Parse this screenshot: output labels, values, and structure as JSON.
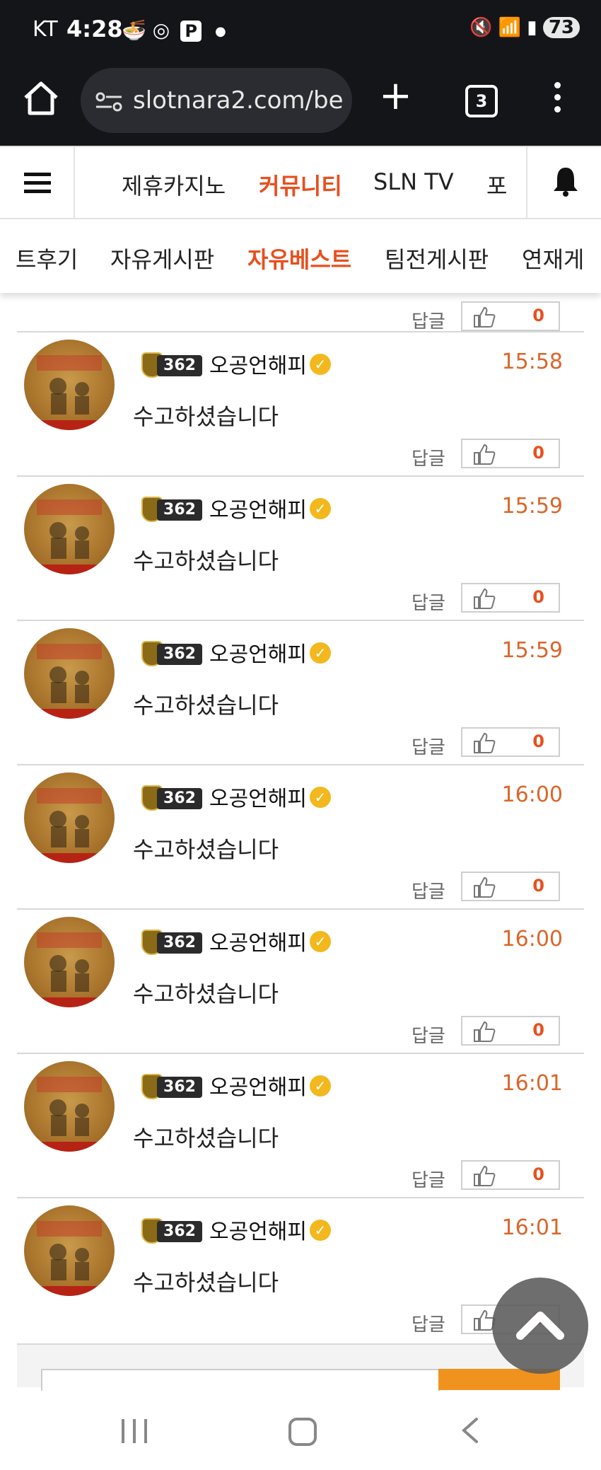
{
  "status_bar": {
    "carrier": "KT",
    "time": "4:28",
    "battery": "73",
    "p_icon_label": "P"
  },
  "browser": {
    "url": "slotnara2.com/be",
    "tab_count": "3"
  },
  "site_nav": {
    "items": [
      {
        "label": "제휴카지노",
        "active": false
      },
      {
        "label": "커뮤니티",
        "active": true
      },
      {
        "label": "SLN TV",
        "active": false
      },
      {
        "label": "포",
        "active": false
      }
    ]
  },
  "sub_nav": {
    "items": [
      {
        "label": "트후기",
        "active": false
      },
      {
        "label": "자유게시판",
        "active": false
      },
      {
        "label": "자유베스트",
        "active": true
      },
      {
        "label": "팀전게시판",
        "active": false
      },
      {
        "label": "연재게",
        "active": false
      }
    ]
  },
  "top_partial": {
    "reply_label": "답글",
    "likes": "0"
  },
  "comments": [
    {
      "level": "362",
      "username": "오공언해피",
      "time": "15:58",
      "text": "수고하셨습니다",
      "reply_label": "답글",
      "likes": "0"
    },
    {
      "level": "362",
      "username": "오공언해피",
      "time": "15:59",
      "text": "수고하셨습니다",
      "reply_label": "답글",
      "likes": "0"
    },
    {
      "level": "362",
      "username": "오공언해피",
      "time": "15:59",
      "text": "수고하셨습니다",
      "reply_label": "답글",
      "likes": "0"
    },
    {
      "level": "362",
      "username": "오공언해피",
      "time": "16:00",
      "text": "수고하셨습니다",
      "reply_label": "답글",
      "likes": "0"
    },
    {
      "level": "362",
      "username": "오공언해피",
      "time": "16:00",
      "text": "수고하셨습니다",
      "reply_label": "답글",
      "likes": "0"
    },
    {
      "level": "362",
      "username": "오공언해피",
      "time": "16:01",
      "text": "수고하셨습니다",
      "reply_label": "답글",
      "likes": "0"
    },
    {
      "level": "362",
      "username": "오공언해피",
      "time": "16:01",
      "text": "수고하셨습니다",
      "reply_label": "답글",
      "likes": "0"
    }
  ],
  "colors": {
    "accent": "#e8501e",
    "time": "#d9662a",
    "status_bg": "#141518",
    "submit_button": "#f0921e"
  }
}
